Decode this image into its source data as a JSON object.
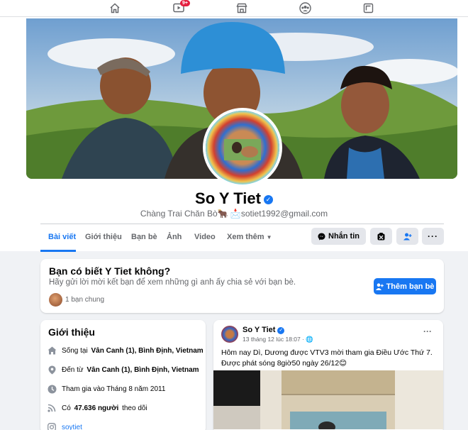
{
  "nav": {
    "icons": [
      "home-icon",
      "watch-icon",
      "marketplace-icon",
      "groups-icon",
      "gaming-icon"
    ],
    "watch_badge": "9+"
  },
  "profile": {
    "name": "So Y Tiet",
    "bio": "Chàng Trai Chăn Bò🐂 📩sotiet1992@gmail.com"
  },
  "tabs": [
    {
      "label": "Bài viết"
    },
    {
      "label": "Giới thiệu"
    },
    {
      "label": "Bạn bè"
    },
    {
      "label": "Ảnh"
    },
    {
      "label": "Video"
    },
    {
      "label": "Xem thêm"
    }
  ],
  "actions": {
    "message_label": "Nhắn tin"
  },
  "know_card": {
    "title": "Bạn có biết Y Tiet không?",
    "subtitle": "Hãy gửi lời mời kết bạn để xem những gì anh ấy chia sẻ với bạn bè.",
    "mutual": "1 bạn chung",
    "add_friend_label": "Thêm bạn bè"
  },
  "intro": {
    "title": "Giới thiệu",
    "lives_prefix": "Sống tại",
    "lives_place": "Vân Canh (1), Bình Định, Vietnam",
    "from_prefix": "Đến từ",
    "from_place": "Vân Canh (1), Bình Định, Vietnam",
    "joined": "Tham gia vào Tháng 8 năm 2011",
    "followers_prefix": "Có",
    "followers_count": "47.636 người",
    "followers_suffix": "theo dõi",
    "instagram": "soytiet"
  },
  "post": {
    "author": "So Y Tiet",
    "time": "13 tháng 12 lúc 18:07 · 🌐",
    "text": "Hôm nay Dì, Dương được VTV3 mời tham gia Điều Ước Thứ 7. Được phát sóng 8giờ50 ngày 26/12😊",
    "more": "···"
  },
  "colors": {
    "accent": "#1877f2",
    "badge": "#e41e3f",
    "page_bg": "#f0f2f5"
  }
}
